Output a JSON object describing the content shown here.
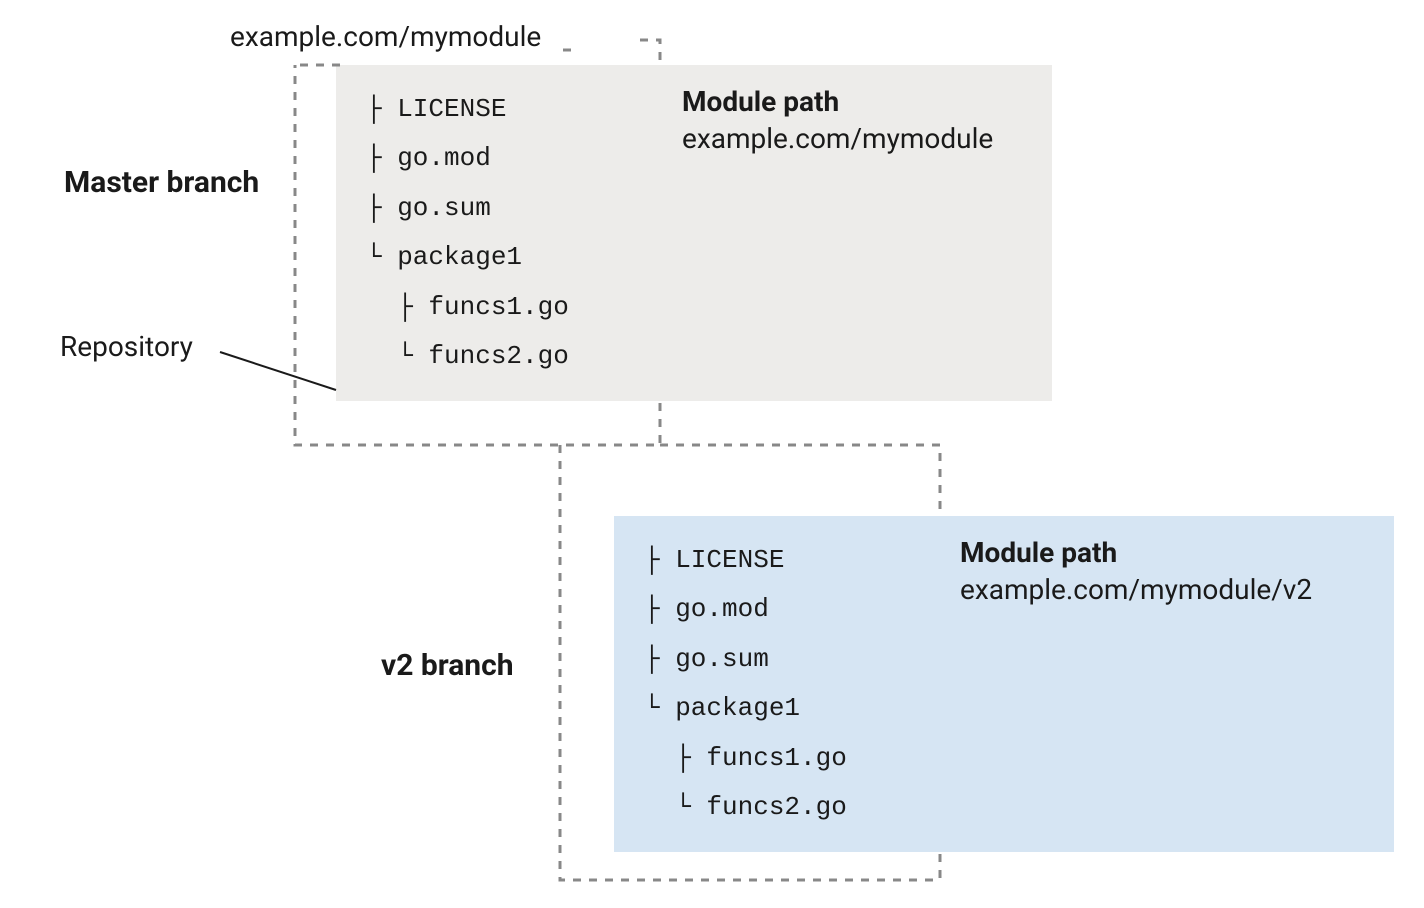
{
  "repositoryLabel": "Repository",
  "moduleUrl": "example.com/mymodule",
  "branches": {
    "master": {
      "label": "Master branch",
      "modulePathTitle": "Module path",
      "modulePathValue": "example.com/mymodule",
      "tree": {
        "files": [
          "LICENSE",
          "go.mod",
          "go.sum",
          "package1"
        ],
        "subfiles": [
          "funcs1.go",
          "funcs2.go"
        ]
      }
    },
    "v2": {
      "label": "v2 branch",
      "modulePathTitle": "Module path",
      "modulePathValue": "example.com/mymodule/v2",
      "tree": {
        "files": [
          "LICENSE",
          "go.mod",
          "go.sum",
          "package1"
        ],
        "subfiles": [
          "funcs1.go",
          "funcs2.go"
        ]
      }
    }
  }
}
